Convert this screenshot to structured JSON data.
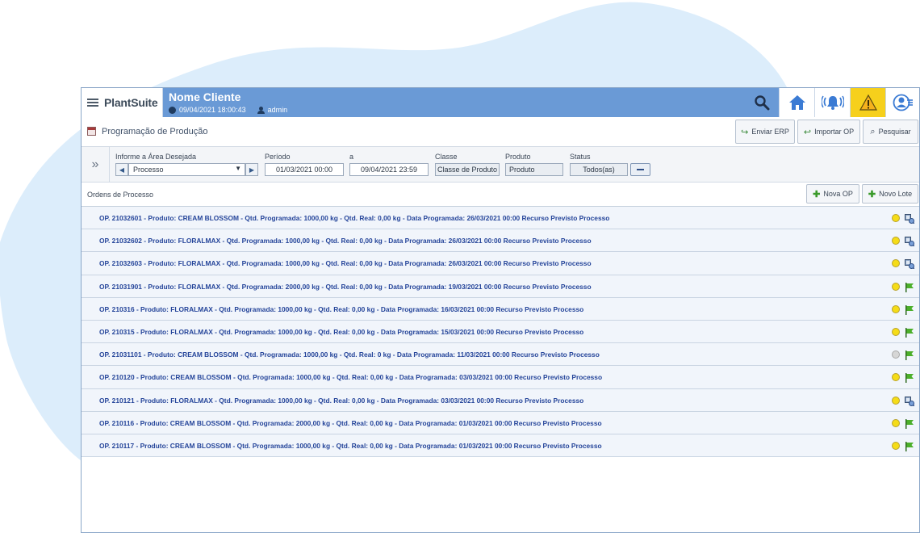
{
  "app": {
    "logo": "PlantSuite",
    "client_name": "Nome Cliente",
    "datetime": "09/04/2021 18:00:43",
    "user": "admin"
  },
  "page": {
    "title": "Programação de Produção",
    "buttons": {
      "enviar_erp": "Enviar ERP",
      "importar_op": "Importar OP",
      "pesquisar": "Pesquisar"
    }
  },
  "filters": {
    "area_label": "Informe a Área Desejada",
    "area_value": "Processo",
    "periodo_label": "Período",
    "periodo_start": "01/03/2021 00:00",
    "a_label": "a",
    "periodo_end": "09/04/2021 23:59",
    "classe_label": "Classe",
    "classe_value": "Classe de Produto",
    "produto_label": "Produto",
    "produto_value": "Produto",
    "status_label": "Status",
    "status_value": "Todos(as)"
  },
  "section": {
    "title": "Ordens de Processo",
    "nova_op": "Nova OP",
    "novo_lote": "Novo Lote"
  },
  "orders": [
    {
      "text": "OP. 21032601 - Produto: CREAM BLOSSOM - Qtd. Programada: 1000,00 kg - Qtd. Real: 0,00 kg - Data Programada: 26/03/2021 00:00 Recurso Previsto Processo",
      "status": "yellow",
      "icon": "resource-icon"
    },
    {
      "text": "OP. 21032602 - Produto: FLORALMAX - Qtd. Programada: 1000,00 kg - Qtd. Real: 0,00 kg - Data Programada: 26/03/2021 00:00 Recurso Previsto Processo",
      "status": "yellow",
      "icon": "resource-icon"
    },
    {
      "text": "OP. 21032603 - Produto: FLORALMAX - Qtd. Programada: 1000,00 kg - Qtd. Real: 0,00 kg - Data Programada: 26/03/2021 00:00 Recurso Previsto Processo",
      "status": "yellow",
      "icon": "resource-icon"
    },
    {
      "text": "OP. 21031901 - Produto: FLORALMAX - Qtd. Programada: 2000,00 kg - Qtd. Real: 0,00 kg - Data Programada: 19/03/2021 00:00 Recurso Previsto Processo",
      "status": "yellow",
      "icon": "flag-icon"
    },
    {
      "text": "OP. 210316 - Produto: FLORALMAX - Qtd. Programada: 1000,00 kg - Qtd. Real: 0,00 kg - Data Programada: 16/03/2021 00:00 Recurso Previsto Processo",
      "status": "yellow",
      "icon": "flag-icon"
    },
    {
      "text": "OP. 210315 - Produto: FLORALMAX - Qtd. Programada: 1000,00 kg - Qtd. Real: 0,00 kg - Data Programada: 15/03/2021 00:00 Recurso Previsto Processo",
      "status": "yellow",
      "icon": "flag-icon"
    },
    {
      "text": "OP. 21031101 - Produto: CREAM BLOSSOM - Qtd. Programada: 1000,00 kg - Qtd. Real: 0 kg - Data Programada: 11/03/2021 00:00 Recurso Previsto Processo",
      "status": "gray",
      "icon": "flag-icon"
    },
    {
      "text": "OP. 210120 - Produto: CREAM BLOSSOM - Qtd. Programada: 1000,00 kg - Qtd. Real: 0,00 kg - Data Programada: 03/03/2021 00:00 Recurso Previsto Processo",
      "status": "yellow",
      "icon": "flag-icon"
    },
    {
      "text": "OP. 210121 - Produto: FLORALMAX - Qtd. Programada: 1000,00 kg - Qtd. Real: 0,00 kg - Data Programada: 03/03/2021 00:00 Recurso Previsto Processo",
      "status": "yellow",
      "icon": "resource-icon"
    },
    {
      "text": "OP. 210116 - Produto: CREAM BLOSSOM - Qtd. Programada: 2000,00 kg - Qtd. Real: 0,00 kg - Data Programada: 01/03/2021 00:00 Recurso Previsto Processo",
      "status": "yellow",
      "icon": "flag-icon"
    },
    {
      "text": "OP. 210117 - Produto: CREAM BLOSSOM - Qtd. Programada: 1000,00 kg - Qtd. Real: 0,00 kg - Data Programada: 01/03/2021 00:00 Recurso Previsto Processo",
      "status": "yellow",
      "icon": "flag-icon"
    }
  ],
  "colors": {
    "topbar": "#6a9ad6",
    "warning": "#f6d01c",
    "link": "#25459a",
    "status_yellow": "#f5dc18",
    "status_gray": "#d6d6d6",
    "flag_green": "#4caf2a"
  }
}
